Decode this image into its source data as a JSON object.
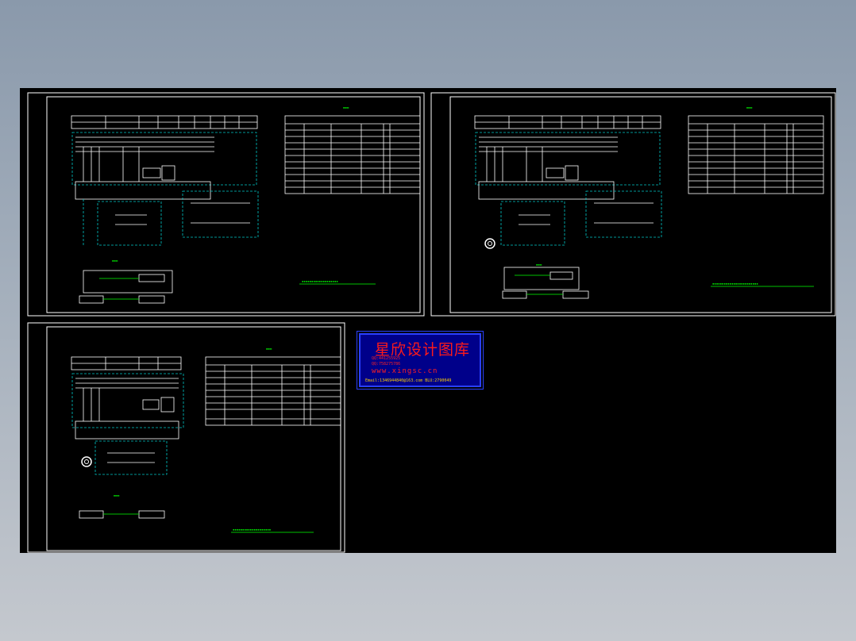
{
  "viewport": {
    "background": "#8a99ab",
    "canvas_color": "#000000",
    "line_color": "#ffffff",
    "wire_color": "#00ff00",
    "dashed_color": "#00c8c8"
  },
  "watermark": {
    "title": "星欣设计图库",
    "url": "www.xingsc.cn",
    "line1": "QQ:441255925",
    "line2": "QQ:758275786",
    "email": "Email:1346944840@163.com  BLU:2790049"
  },
  "sheets": [
    {
      "id": "sheet-1",
      "motor": "none"
    },
    {
      "id": "sheet-2",
      "motor": "circle"
    },
    {
      "id": "sheet-3",
      "motor": "circle"
    }
  ]
}
